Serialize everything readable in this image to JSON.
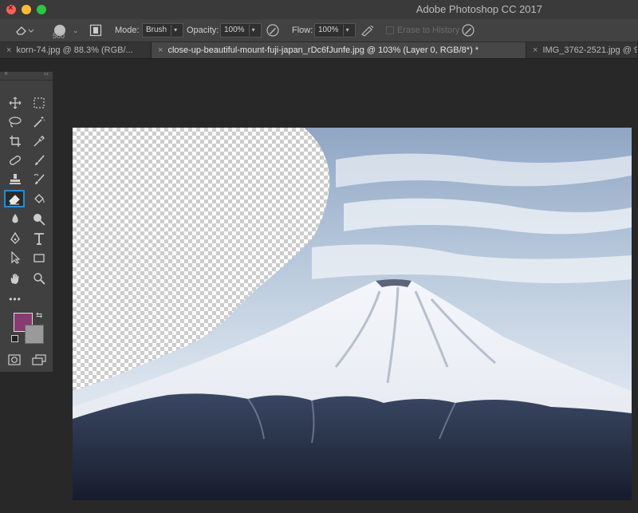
{
  "window": {
    "title": "Adobe Photoshop CC 2017"
  },
  "options": {
    "brush_size": "500",
    "mode_label": "Mode:",
    "mode_value": "Brush",
    "opacity_label": "Opacity:",
    "opacity_value": "100%",
    "flow_label": "Flow:",
    "flow_value": "100%",
    "erase_history_label": "Erase to History"
  },
  "tabs": [
    {
      "label": "korn-74.jpg @ 88.3% (RGB/..."
    },
    {
      "label": "close-up-beautiful-mount-fuji-japan_rDc6fJunfe.jpg @ 103% (Layer 0, RGB/8*) *"
    },
    {
      "label": "IMG_3762-2521.jpg @ 9"
    }
  ],
  "tools": [
    "move-tool",
    "marquee-tool",
    "lasso-tool",
    "magic-wand-tool",
    "crop-tool",
    "eyedropper-tool",
    "healing-brush-tool",
    "brush-tool",
    "clone-stamp-tool",
    "history-brush-tool",
    "eraser-tool",
    "paint-bucket-tool",
    "blur-tool",
    "dodge-tool",
    "pen-tool",
    "type-tool",
    "path-selection-tool",
    "rectangle-tool",
    "hand-tool",
    "zoom-tool",
    "edit-toolbar",
    "quick-mask",
    "screen-mode"
  ],
  "colors": {
    "foreground": "#8a3a72",
    "background": "#9a9a9a",
    "selected_tool_highlight": "#1e90d8"
  }
}
